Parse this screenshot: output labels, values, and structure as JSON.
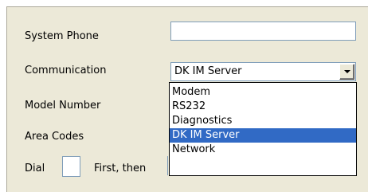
{
  "form": {
    "system_phone": {
      "label": "System Phone",
      "value": ""
    },
    "communication": {
      "label": "Communication",
      "selected": "DK IM Server",
      "options": [
        "Modem",
        "RS232",
        "Diagnostics",
        "DK IM Server",
        "Network"
      ],
      "highlighted_option": "DK IM Server"
    },
    "model_number": {
      "label": "Model Number"
    },
    "area_codes": {
      "label": "Area Codes"
    },
    "dial": {
      "label": "Dial",
      "value": "",
      "suffix": "First, then"
    }
  },
  "colors": {
    "panel_bg": "#ece9d8",
    "field_border": "#7f9db9",
    "selection_bg": "#316ac5",
    "selection_fg": "#ffffff"
  },
  "icons": {
    "combo_arrow": "chevron-down-icon"
  }
}
